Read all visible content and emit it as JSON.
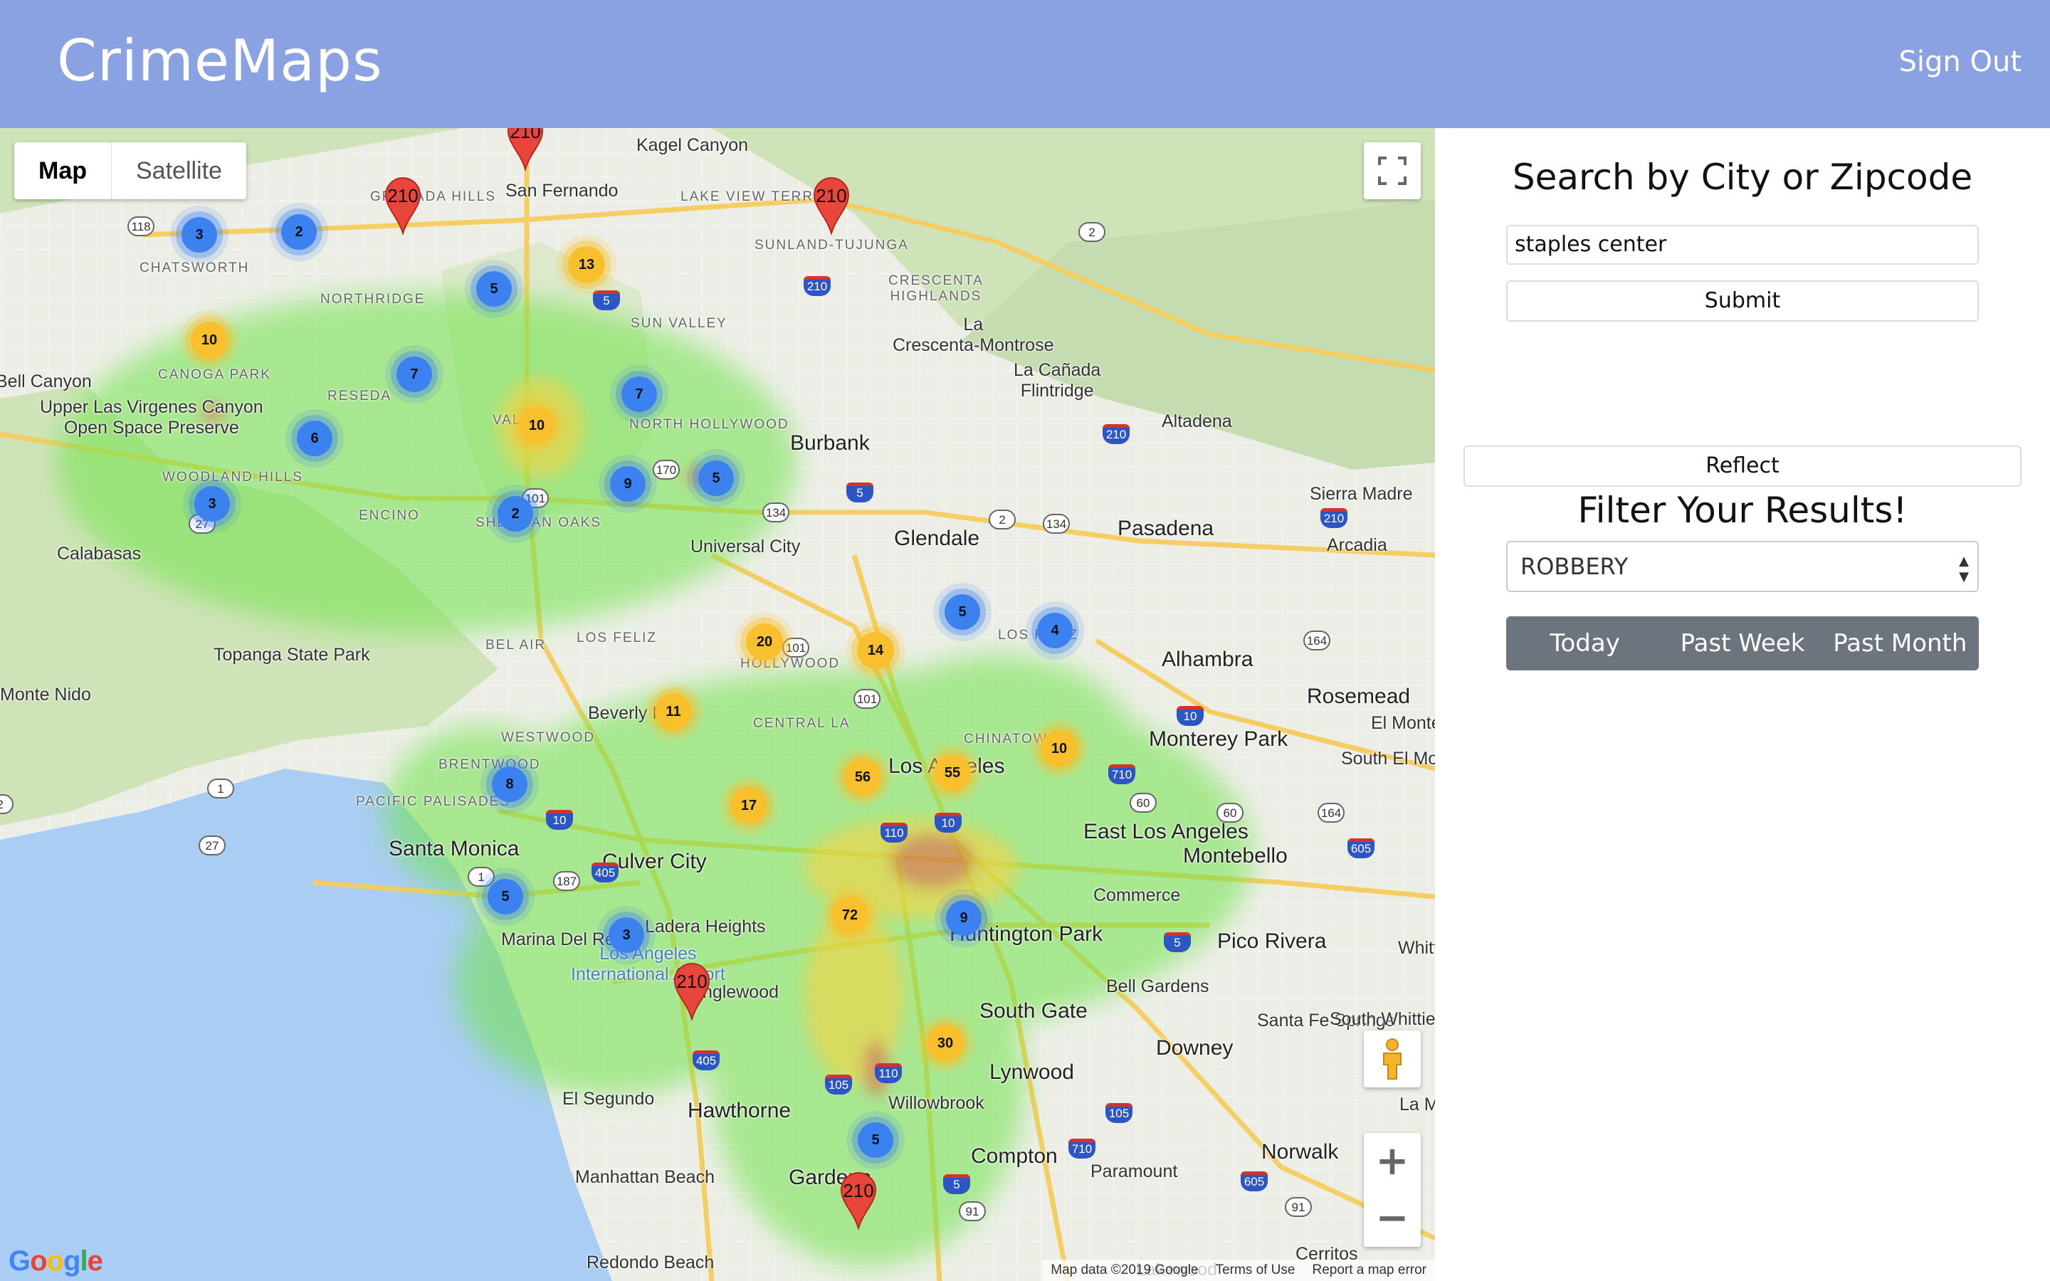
{
  "app": {
    "title": "CrimeMaps",
    "sign_out": "Sign Out",
    "nav_color": "#8aa1e2"
  },
  "map": {
    "type_control": {
      "map": "Map",
      "satellite": "Satellite"
    },
    "footer": {
      "data": "Map data ©2019 Google",
      "terms": "Terms of Use",
      "report": "Report a map error"
    },
    "logo": "Google",
    "zoom_in": "+",
    "zoom_out": "−",
    "places": [
      "Kagel Canyon",
      "GRANADA HILLS",
      "San Fernando",
      "LAKE VIEW TERRACE",
      "SUNLAND-TUJUNGA",
      "CHATSWORTH",
      "NORTHRIDGE",
      "CRESCENTA HIGHLANDS",
      "La Crescenta-Montrose",
      "SUN VALLEY",
      "La Cañada Flintridge",
      "Bell Canyon",
      "CANOGA PARK",
      "RESEDA",
      "NORTH HOLLYWOOD",
      "Altadena",
      "Upper Las Virgenes Canyon Open Space Preserve",
      "Burbank",
      "WOODLAND HILLS",
      "VALLEY",
      "Sierra Madre",
      "ENCINO",
      "SHERMAN OAKS",
      "Universal City",
      "Glendale",
      "Pasadena",
      "Arcadia",
      "Calabasas",
      "LOS FELIZ",
      "LOS FELIZ",
      "Alhambra",
      "BEL AIR",
      "HOLLYWOOD",
      "Rosemead",
      "Topanga State Park",
      "Monte Nido",
      "Beverly Hills",
      "CENTRAL LA",
      "CHINATOWN",
      "Monterey Park",
      "El Monte",
      "WESTWOOD",
      "Los Angeles",
      "South El Monte",
      "BRENTWOOD",
      "PACIFIC PALISADES",
      "East Los Angeles",
      "Montebello",
      "Santa Monica",
      "Culver City",
      "Commerce",
      "Pico Rivera",
      "Whittier",
      "Ladera Heights",
      "Huntington Park",
      "Marina Del Rey",
      "Los Angeles International Airport",
      "Bell Gardens",
      "Inglewood",
      "South Gate",
      "Santa Fe Springs",
      "South Whittier",
      "Downey",
      "El Segundo",
      "Lynwood",
      "Hawthorne",
      "Willowbrook",
      "La Mirada",
      "Compton",
      "Norwalk",
      "Paramount",
      "Manhattan Beach",
      "Gardena",
      "Cerritos",
      "Redondo Beach",
      "Lakewood"
    ],
    "clusters": [
      {
        "n": "3",
        "level": "blue"
      },
      {
        "n": "2",
        "level": "blue"
      },
      {
        "n": "13",
        "level": "yellow"
      },
      {
        "n": "5",
        "level": "blue"
      },
      {
        "n": "10",
        "level": "yellow"
      },
      {
        "n": "7",
        "level": "blue"
      },
      {
        "n": "7",
        "level": "blue"
      },
      {
        "n": "10",
        "level": "yellow"
      },
      {
        "n": "6",
        "level": "blue"
      },
      {
        "n": "9",
        "level": "blue"
      },
      {
        "n": "5",
        "level": "blue"
      },
      {
        "n": "3",
        "level": "blue"
      },
      {
        "n": "2",
        "level": "blue"
      },
      {
        "n": "5",
        "level": "blue"
      },
      {
        "n": "4",
        "level": "blue"
      },
      {
        "n": "20",
        "level": "yellow"
      },
      {
        "n": "14",
        "level": "yellow"
      },
      {
        "n": "11",
        "level": "yellow"
      },
      {
        "n": "10",
        "level": "yellow"
      },
      {
        "n": "56",
        "level": "yellow"
      },
      {
        "n": "55",
        "level": "yellow"
      },
      {
        "n": "8",
        "level": "blue"
      },
      {
        "n": "17",
        "level": "yellow"
      },
      {
        "n": "5",
        "level": "blue"
      },
      {
        "n": "72",
        "level": "yellow"
      },
      {
        "n": "3",
        "level": "blue"
      },
      {
        "n": "9",
        "level": "blue"
      },
      {
        "n": "30",
        "level": "yellow"
      },
      {
        "n": "5",
        "level": "blue"
      }
    ],
    "pins": [
      "210",
      "210",
      "210",
      "210",
      "210"
    ],
    "shields": [
      "118",
      "2",
      "210",
      "5",
      "170",
      "101",
      "134",
      "2",
      "134",
      "210",
      "210",
      "5",
      "101",
      "101",
      "164",
      "10",
      "710",
      "60",
      "60",
      "164",
      "605",
      "1",
      "10",
      "405",
      "187",
      "10",
      "110",
      "1",
      "105",
      "110",
      "105",
      "405",
      "710",
      "5",
      "605",
      "91",
      "91",
      "27",
      "5",
      "2",
      "27"
    ]
  },
  "panel": {
    "search_title": "Search by City or Zipcode",
    "search_value": "staples center",
    "submit": "Submit",
    "reflect": "Reflect",
    "filter_title": "Filter Your Results!",
    "filter_selected": "ROBBERY",
    "ranges": [
      "Today",
      "Past Week",
      "Past Month"
    ]
  }
}
